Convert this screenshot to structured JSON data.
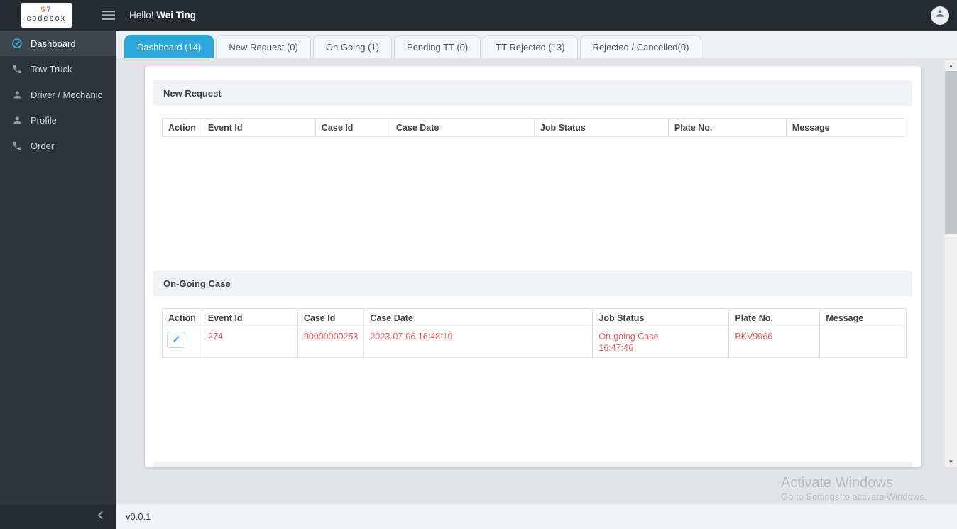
{
  "topbar": {
    "logo_top": "57",
    "logo_text": "codebox",
    "greeting_prefix": "Hello!",
    "user_name": "Wei Ting"
  },
  "sidebar": {
    "items": [
      {
        "label": "Dashboard",
        "icon": "gauge-icon",
        "active": true
      },
      {
        "label": "Tow Truck",
        "icon": "phone-icon",
        "active": false
      },
      {
        "label": "Driver / Mechanic",
        "icon": "person-icon",
        "active": false
      },
      {
        "label": "Profile",
        "icon": "person-icon",
        "active": false
      },
      {
        "label": "Order",
        "icon": "phone-icon",
        "active": false
      }
    ]
  },
  "tabs": [
    {
      "label": "Dashboard (14)",
      "active": true
    },
    {
      "label": "New Request (0)",
      "active": false
    },
    {
      "label": "On Going (1)",
      "active": false
    },
    {
      "label": "Pending TT (0)",
      "active": false
    },
    {
      "label": "TT Rejected (13)",
      "active": false
    },
    {
      "label": "Rejected / Cancelled(0)",
      "active": false
    }
  ],
  "new_request": {
    "title": "New Request",
    "columns": [
      "Action",
      "Event Id",
      "Case Id",
      "Case Date",
      "Job Status",
      "Plate No.",
      "Message"
    ],
    "rows": []
  },
  "ongoing": {
    "title": "On-Going Case",
    "columns": [
      "Action",
      "Event Id",
      "Case Id",
      "Case Date",
      "Job Status",
      "Plate No.",
      "Message"
    ],
    "row": {
      "event_id": "274",
      "case_id": "90000000253",
      "case_date": "2023-07-06 16:48:19",
      "job_status_line1": "On-going Case",
      "job_status_line2": "16:47:46",
      "plate_no": "BKV9966",
      "message": ""
    }
  },
  "footer": {
    "version": "v0.0.1"
  },
  "watermark": {
    "line1": "Activate Windows",
    "line2": "Go to Settings to activate Windows."
  },
  "colors": {
    "accent_blue": "#2BA9DC",
    "danger_red": "#FA5C5C",
    "topbar_bg": "#262B32",
    "sidebar_bg": "#2F343C"
  }
}
